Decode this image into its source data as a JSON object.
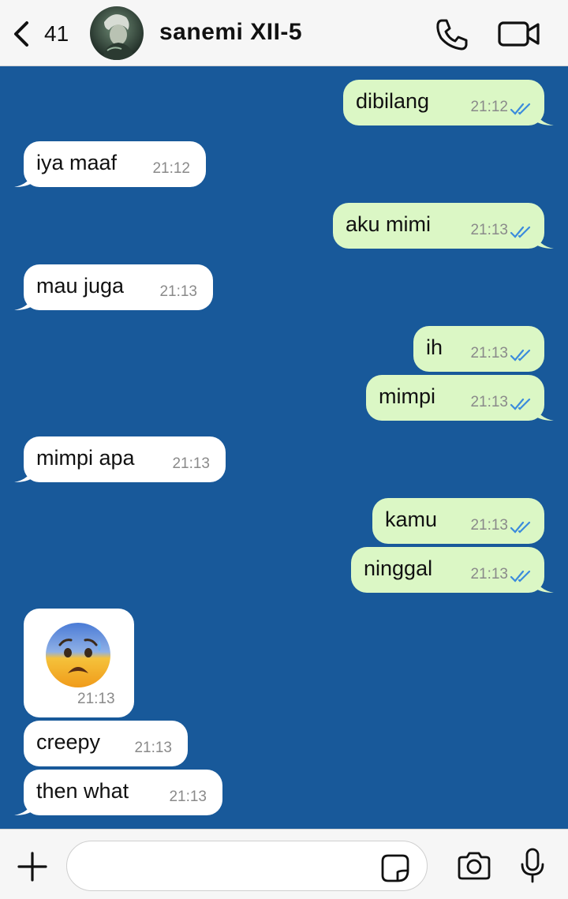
{
  "header": {
    "back_count": "41",
    "contact_name": "sanemi XII-5",
    "avatar_icon": "contact-avatar",
    "call_icon": "phone-icon",
    "video_icon": "video-camera-icon"
  },
  "colors": {
    "chat_background": "#18599a",
    "outgoing_bubble": "#dbf7c5",
    "incoming_bubble": "#ffffff",
    "read_ticks": "#3b8bdc",
    "header_background": "#f6f6f6"
  },
  "messages": [
    {
      "direction": "out",
      "text": "dibilang",
      "time": "21:12",
      "status": "read"
    },
    {
      "direction": "in",
      "text": "iya maaf",
      "time": "21:12"
    },
    {
      "direction": "out",
      "text": "aku mimi",
      "time": "21:13",
      "status": "read"
    },
    {
      "direction": "in",
      "text": "mau juga",
      "time": "21:13"
    },
    {
      "direction": "out",
      "text": "ih",
      "time": "21:13",
      "status": "read"
    },
    {
      "direction": "out",
      "text": "mimpi",
      "time": "21:13",
      "status": "read"
    },
    {
      "direction": "in",
      "text": "mimpi apa",
      "time": "21:13"
    },
    {
      "direction": "out",
      "text": "kamu",
      "time": "21:13",
      "status": "read"
    },
    {
      "direction": "out",
      "text": "ninggal",
      "time": "21:13",
      "status": "read"
    },
    {
      "direction": "in",
      "emoji": "anxious-face-with-sweat",
      "time": "21:13"
    },
    {
      "direction": "in",
      "text": "creepy",
      "time": "21:13"
    },
    {
      "direction": "in",
      "text": "then what",
      "time": "21:13"
    }
  ],
  "composer": {
    "input_value": "",
    "plus_icon": "plus-icon",
    "sticker_icon": "sticker-icon",
    "camera_icon": "camera-icon",
    "mic_icon": "microphone-icon"
  }
}
